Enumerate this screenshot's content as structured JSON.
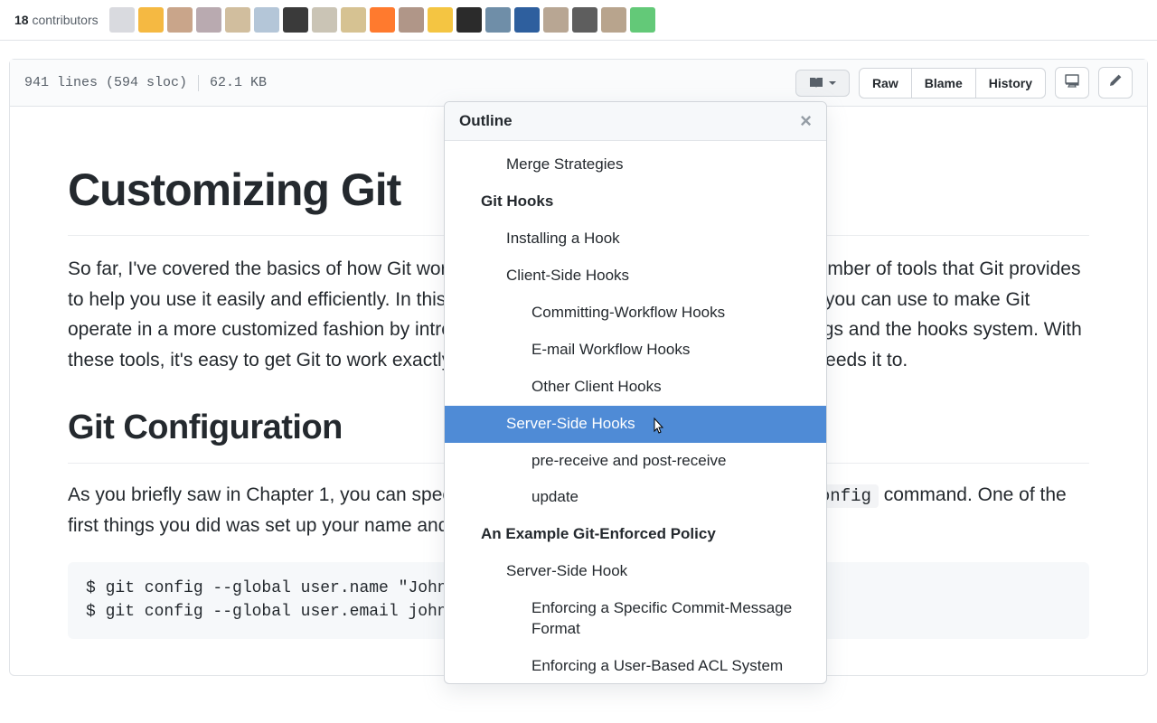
{
  "contributors": {
    "count": "18",
    "label": "contributors",
    "avatar_colors": [
      "#d9dadf",
      "#f5b942",
      "#c9a58a",
      "#b9aab0",
      "#d1be9e",
      "#b4c6d8",
      "#3a3a3a",
      "#cac4b5",
      "#d6c292",
      "#ff7a2e",
      "#b09688",
      "#f4c542",
      "#2b2b2b",
      "#6f8ea8",
      "#2e5f9e",
      "#b8a693",
      "#5e5e5e",
      "#b8a48d",
      "#63c978"
    ]
  },
  "fileinfo": {
    "lines": "941 lines (594 sloc)",
    "size": "62.1 KB"
  },
  "actions": {
    "raw": "Raw",
    "blame": "Blame",
    "history": "History"
  },
  "content": {
    "h1": "Customizing Git",
    "p1": "So far, I've covered the basics of how Git works and how to use it, and I've introduced a number of tools that Git provides to help you use it easily and efficiently. In this chapter, I'll go through some operations that you can use to make Git operate in a more customized fashion by introducing several important configuration settings and the hooks system. With these tools, it's easy to get Git to work exactly the way you, your company, or your group needs it to.",
    "h2": "Git Configuration",
    "p2a": "As you briefly saw in Chapter 1, you can specify Git configuration settings with the ",
    "p2code": "git config",
    "p2b": " command. One of the first things you did was set up your name and e-mail address:",
    "code": "$ git config --global user.name \"John Doe\"\n$ git config --global user.email johndoe@example.com"
  },
  "outline": {
    "title": "Outline",
    "items": [
      {
        "label": "Merge Strategies",
        "level": 2,
        "selected": false
      },
      {
        "label": "Git Hooks",
        "level": 1,
        "selected": false
      },
      {
        "label": "Installing a Hook",
        "level": 2,
        "selected": false
      },
      {
        "label": "Client-Side Hooks",
        "level": 2,
        "selected": false
      },
      {
        "label": "Committing-Workflow Hooks",
        "level": 3,
        "selected": false
      },
      {
        "label": "E-mail Workflow Hooks",
        "level": 3,
        "selected": false
      },
      {
        "label": "Other Client Hooks",
        "level": 3,
        "selected": false
      },
      {
        "label": "Server-Side Hooks",
        "level": 2,
        "selected": true
      },
      {
        "label": "pre-receive and post-receive",
        "level": 3,
        "selected": false
      },
      {
        "label": "update",
        "level": 3,
        "selected": false
      },
      {
        "label": "An Example Git-Enforced Policy",
        "level": 1,
        "selected": false
      },
      {
        "label": "Server-Side Hook",
        "level": 2,
        "selected": false
      },
      {
        "label": "Enforcing a Specific Commit-Message Format",
        "level": 3,
        "selected": false,
        "wrap": true
      },
      {
        "label": "Enforcing a User-Based ACL System",
        "level": 3,
        "selected": false
      }
    ]
  }
}
